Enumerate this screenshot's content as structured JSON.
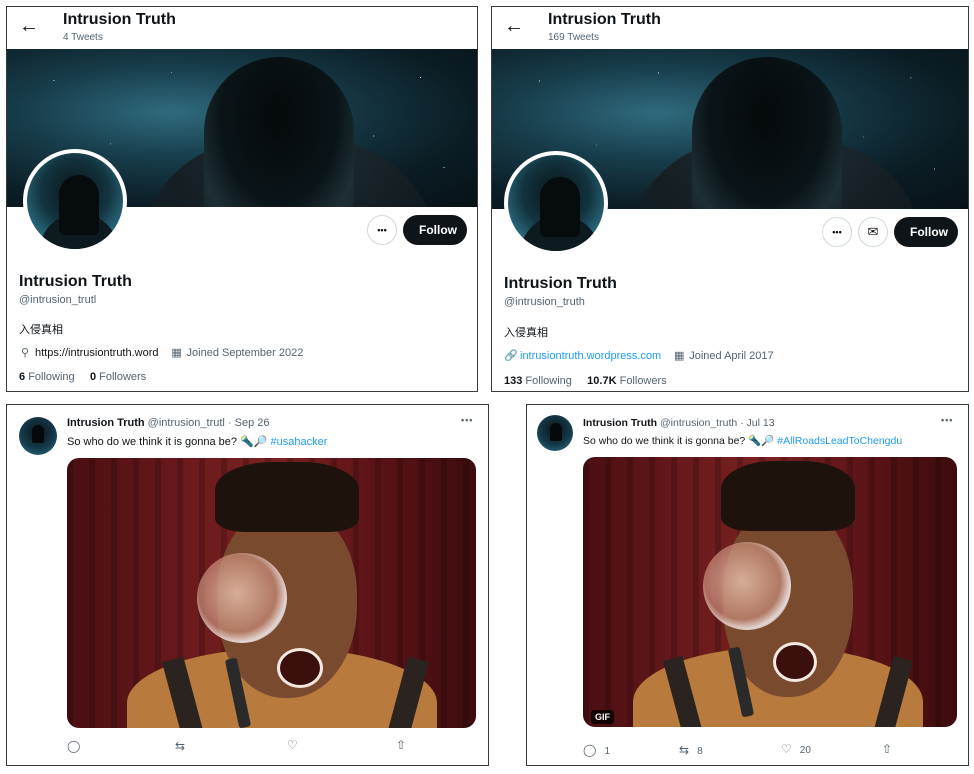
{
  "left_profile": {
    "top_name": "Intrusion Truth",
    "tweet_count": "4 Tweets",
    "display_name": "Intrusion Truth",
    "handle": "@intrusion_trutl",
    "bio": "入侵真相",
    "website": "https://intrusiontruth.word",
    "joined": "Joined September 2022",
    "following_count": "6",
    "following_label": "Following",
    "followers_count": "0",
    "followers_label": "Followers",
    "follow_label": "Follow",
    "more_label": "•••"
  },
  "right_profile": {
    "top_name": "Intrusion Truth",
    "tweet_count": "169 Tweets",
    "display_name": "Intrusion Truth",
    "handle": "@intrusion_truth",
    "bio": "入侵真相",
    "website": "intrusiontruth.wordpress.com",
    "joined": "Joined April 2017",
    "following_count": "133",
    "following_label": "Following",
    "followers_count": "10.7K",
    "followers_label": "Followers",
    "follow_label": "Follow",
    "more_label": "•••"
  },
  "left_tweet": {
    "name": "Intrusion Truth",
    "handle": "@intrusion_trutl",
    "date": "· Sep 26",
    "text": "So who do we think it is gonna be? 🔦🔎 ",
    "hashtag": "#usahacker",
    "more": "•••"
  },
  "right_tweet": {
    "name": "Intrusion Truth",
    "handle": "@intrusion_truth",
    "date": "· Jul 13",
    "text": "So who do we think it is gonna be? 🔦🔎 ",
    "hashtag": "#AllRoadsLeadToChengdu",
    "more": "•••",
    "gif_badge": "GIF",
    "reply_count": "1",
    "retweet_count": "8",
    "like_count": "20"
  },
  "icons": {
    "back": "arrow-left-icon",
    "location": "location-pin-icon",
    "link": "link-icon",
    "calendar": "calendar-icon",
    "mail": "mail-icon",
    "reply": "reply-icon",
    "retweet": "retweet-icon",
    "like": "heart-icon",
    "share": "share-icon"
  },
  "colors": {
    "link_blue": "#1d9bf0",
    "follow_button": "#0f1419",
    "secondary_text": "#536471"
  }
}
